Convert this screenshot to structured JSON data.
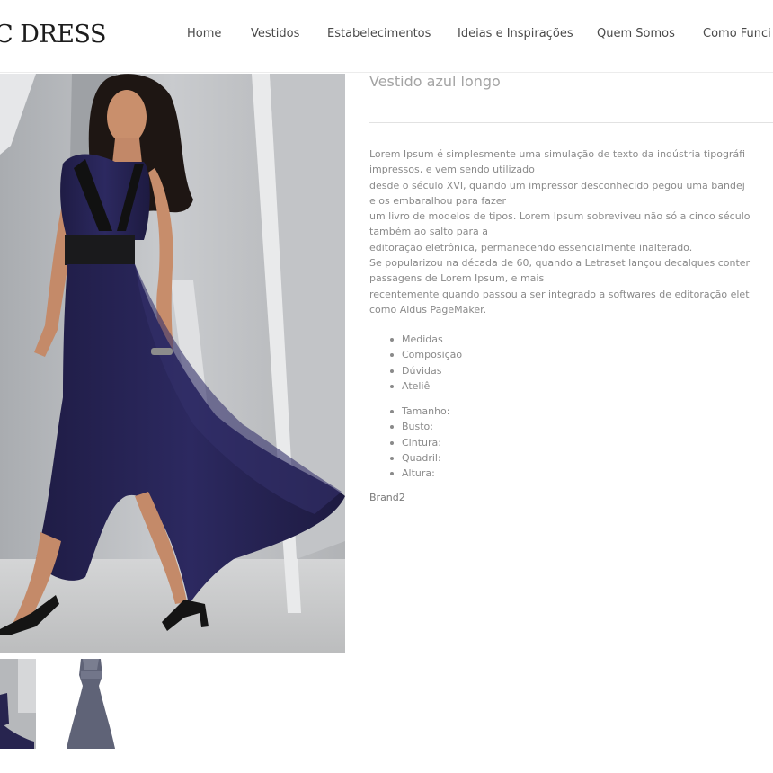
{
  "header": {
    "logo": "C DRESS",
    "nav": [
      {
        "label": "Home"
      },
      {
        "label": "Vestidos"
      },
      {
        "label": "Estabelecimentos"
      },
      {
        "label": "Ideias e Inspirações"
      },
      {
        "label": "Quem Somos"
      },
      {
        "label": "Como Funci"
      }
    ]
  },
  "product": {
    "title": "Vestido azul longo",
    "description_lines": [
      "Lorem Ipsum é simplesmente uma simulação de texto da indústria tipográfi",
      "impressos, e vem sendo utilizado",
      "desde o século XVI, quando um impressor desconhecido pegou uma bandej",
      "e os embaralhou para fazer",
      "um livro de modelos de tipos. Lorem Ipsum sobreviveu não só a cinco século",
      "também ao salto para a",
      "editoração eletrônica, permanecendo essencialmente inalterado.",
      "Se popularizou na década de 60, quando a Letraset lançou decalques conter",
      "passagens de Lorem Ipsum, e mais",
      "recentemente quando passou a ser integrado a softwares de editoração elet",
      "como Aldus PageMaker."
    ],
    "info_links": [
      "Medidas",
      "Composição",
      "Dúvidas",
      "Ateliê"
    ],
    "size_fields": [
      "Tamanho:",
      "Busto:",
      "Cintura:",
      "Quadril:",
      "Altura:"
    ],
    "brand": "Brand2"
  },
  "colors": {
    "dress": "#27244f",
    "belt": "#1b1b1d",
    "background_gray": "#bdbfc2",
    "text": "#8a8a8a"
  },
  "icons": {
    "main_photo": "dress-photo",
    "thumb_1": "dress-thumbnail",
    "thumb_2": "dress-thumbnail"
  }
}
